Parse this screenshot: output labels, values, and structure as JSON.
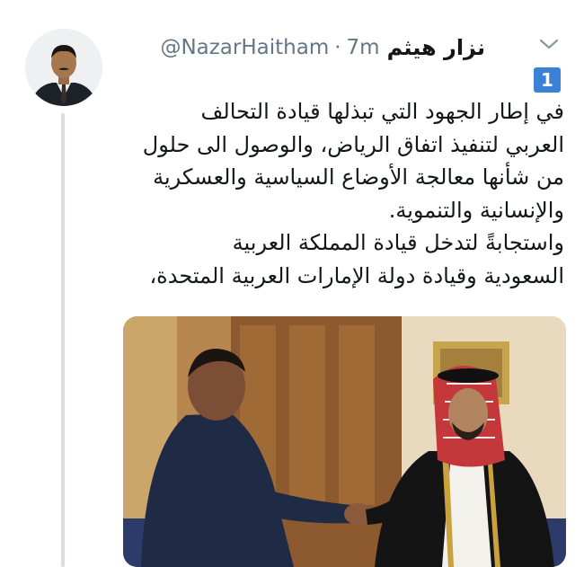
{
  "tweet": {
    "display_name": "نزار هيثم",
    "handle": "@NazarHaitham",
    "separator": "·",
    "time": "7m",
    "thread_number": "1",
    "text_lines": [
      "في إطار الجهود التي تبذلها قيادة التحالف",
      "العربي لتنفيذ اتفاق الرياض، والوصول الى حلول",
      "من شأنها معالجة الأوضاع السياسية والعسكرية",
      "والإنسانية والتنموية.",
      "واستجابةً لتدخل قيادة المملكة العربية",
      "السعودية وقيادة دولة الإمارات العربية المتحدة،"
    ]
  },
  "icons": {
    "menu": "chevron-down-icon",
    "badge": "keycap-number-icon"
  },
  "colors": {
    "text": "#14171a",
    "secondary": "#657786",
    "badge": "#3b82d6",
    "thread_line": "#d8dde2"
  }
}
